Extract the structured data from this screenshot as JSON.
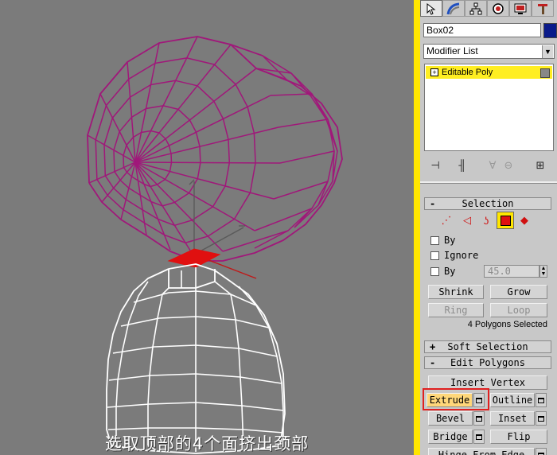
{
  "caption": "选取顶部的4个面挤出颈部",
  "command_tabs": [
    {
      "icon": "create-icon",
      "active": true
    },
    {
      "icon": "modify-icon",
      "active": false
    },
    {
      "icon": "hierarchy-icon",
      "active": false
    },
    {
      "icon": "motion-icon",
      "active": false
    },
    {
      "icon": "display-icon",
      "active": false
    },
    {
      "icon": "utilities-icon",
      "active": false
    }
  ],
  "object_name": "Box02",
  "object_color": "#0a1a8a",
  "modifier_list_label": "Modifier List",
  "stack_item": "Editable Poly",
  "stack_highlight_color": "#ffee22",
  "selection": {
    "title": "Selection",
    "sign": "-",
    "checkboxes": [
      {
        "label": "By"
      },
      {
        "label": "Ignore"
      },
      {
        "label": "By"
      }
    ],
    "angle_value": "45.0",
    "shrink": "Shrink",
    "grow": "Grow",
    "ring": "Ring",
    "loop": "Loop",
    "status": "4 Polygons Selected"
  },
  "soft_selection": {
    "title": "Soft Selection",
    "sign": "+"
  },
  "edit_polygons": {
    "title": "Edit Polygons",
    "sign": "-",
    "insert_vertex": "Insert Vertex",
    "extrude": "Extrude",
    "outline": "Outline",
    "bevel": "Bevel",
    "inset": "Inset",
    "bridge": "Bridge",
    "flip": "Flip",
    "hinge_from_edge": "Hinge From Edge"
  },
  "colors": {
    "viewport_bg": "#7b7b7b",
    "head_wire": "#a0187a",
    "body_wire": "#ffffff",
    "selected_poly": "#e01010",
    "accent": "#ffe600",
    "highlight_border": "#e02020"
  }
}
